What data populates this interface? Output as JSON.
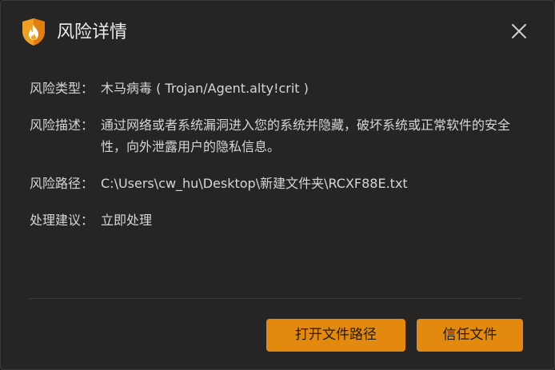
{
  "dialog": {
    "title": "风险详情"
  },
  "details": {
    "type": {
      "label": "风险类型：",
      "value": "木马病毒 ( Trojan/Agent.alty!crit )"
    },
    "description": {
      "label": "风险描述：",
      "value": "通过网络或者系统漏洞进入您的系统并隐藏，破坏系统或正常软件的安全性，向外泄露用户的隐私信息。"
    },
    "path": {
      "label": "风险路径：",
      "value": "C:\\Users\\cw_hu\\Desktop\\新建文件夹\\RCXF88E.txt"
    },
    "suggestion": {
      "label": "处理建议：",
      "value": "立即处理"
    }
  },
  "actions": {
    "open_path_label": "打开文件路径",
    "trust_label": "信任文件"
  },
  "colors": {
    "background": "#252525",
    "accent": "#e38a0e",
    "text": "#d6d6d6"
  },
  "icons": {
    "logo": "shield-flame-icon",
    "close": "close-icon"
  }
}
